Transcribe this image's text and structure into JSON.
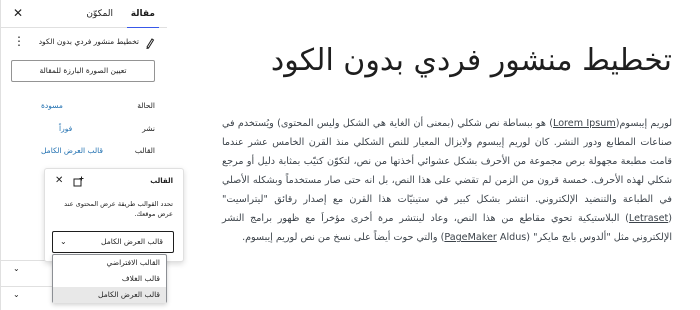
{
  "post": {
    "title": "تخطيط منشور فردي بدون الكود",
    "body_before_lorem": "لوريم إيبسوم(",
    "lorem_link": "Lorem Ipsum",
    "body_part2": ") هو ببساطة نص شكلي (بمعنى أن الغاية هي الشكل وليس المحتوى) ويُستخدم في صناعات المطابع ودور النشر. كان لوريم إيبسوم ولايزال المعيار للنص الشكلي منذ القرن الخامس عشر عندما قامت مطبعة مجهولة برص مجموعة من الأحرف بشكل عشوائي أخذتها من نص، لتكوّن كتيّب بمثابة دليل أو مرجع شكلي لهذه الأحرف. خمسة قرون من الزمن لم تقضي على هذا النص، بل انه حتى صار مستخدماً وبشكله الأصلي في الطباعة والتنضيد الإلكتروني. انتشر بشكل كبير في ستينيّات هذا القرن مع إصدار رقائق \"ليتراسيت\" (",
    "letraset_link": "Letraset",
    "body_part3": ") البلاستيكية تحوي مقاطع من هذا النص، وعاد لينتشر مرة أخرى مؤخراَ مع ظهور برامج النشر الإلكتروني مثل \"ألدوس بايج مايكر\" (Aldus ",
    "pagemaker_link": "PageMaker",
    "body_part4": ") والتي حوت أيضاً على نسخ من نص لوريم إيبسوم."
  },
  "sidebar": {
    "tabs": {
      "post": "مقالة",
      "block": "المكوّن"
    },
    "close_icon": "close-icon",
    "summary": {
      "icon": "pen-icon",
      "text": "تخطيط منشور فردي بدون الكود"
    },
    "featured_button": "تعيين الصورة البارزة للمقالة",
    "props": [
      {
        "label": "الحالة",
        "value": "مسودة"
      },
      {
        "label": "نشر",
        "value": "فوراً"
      },
      {
        "label": "القالب",
        "value": "قالب العرض الكامل"
      }
    ]
  },
  "template_popover": {
    "title": "القالب",
    "description": "تحدد القوالب طريقة عرض المحتوى عند عرض موقعك.",
    "selected": "قالب العرض الكامل",
    "options": [
      "القالب الافتراضي",
      "قالب الغلاف",
      "قالب العرض الكامل"
    ],
    "selected_index": 2
  },
  "colors": {
    "accent": "#3858e9",
    "link": "#2271b1"
  }
}
